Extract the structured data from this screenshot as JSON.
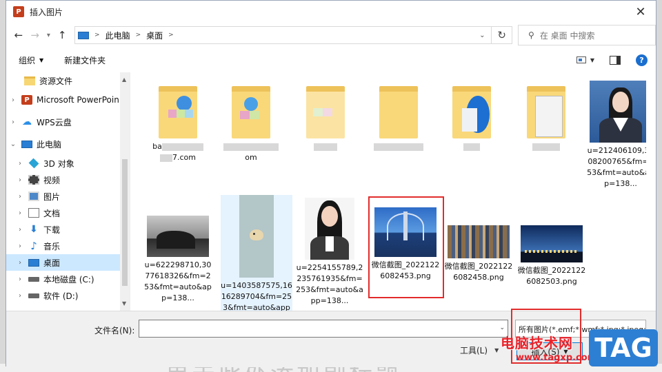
{
  "dialog": {
    "title": "插入图片"
  },
  "nav": {
    "path": [
      "此电脑",
      "桌面"
    ],
    "search_placeholder": "在 桌面 中搜索"
  },
  "toolbar": {
    "organize": "组织",
    "new_folder": "新建文件夹",
    "help": "?"
  },
  "sidebar": {
    "items": [
      {
        "label": "资源文件",
        "icon": "folder-icon"
      },
      {
        "label": "Microsoft PowerPoin",
        "icon": "powerpoint-icon"
      },
      {
        "label": "WPS云盘",
        "icon": "cloud-icon"
      },
      {
        "label": "此电脑",
        "icon": "computer-icon"
      },
      {
        "label": "3D 对象",
        "icon": "cube-icon"
      },
      {
        "label": "视频",
        "icon": "video-icon"
      },
      {
        "label": "图片",
        "icon": "picture-icon"
      },
      {
        "label": "文档",
        "icon": "document-icon"
      },
      {
        "label": "下载",
        "icon": "download-icon"
      },
      {
        "label": "音乐",
        "icon": "music-icon"
      },
      {
        "label": "桌面",
        "icon": "desktop-icon"
      },
      {
        "label": "本地磁盘 (C:)",
        "icon": "disk-icon"
      },
      {
        "label": "软件 (D:)",
        "icon": "disk-icon"
      }
    ]
  },
  "files": {
    "folder1_a": "ba",
    "folder1_b": "7.com",
    "folder2_b": "om",
    "img1": "u=212406109,3008200765&fm=253&fmt=auto&app=138...",
    "img2": "u=622298710,3077618326&fm=253&fmt=auto&app=138...",
    "img3": "u=1403587575,1616289704&fm=253&fmt=auto&app=120...",
    "img4": "u=2254155789,2235761935&fm=253&fmt=auto&app=138...",
    "img5": "微信截图_20221226082453.png",
    "img6": "微信截图_20221226082458.png",
    "img7": "微信截图_20221226082503.png"
  },
  "bottom": {
    "filename_label": "文件名(N):",
    "filename_value": "",
    "filetype": "所有图片(*.emf;*.wmf;*.jpg;*.jpeg;*.png)",
    "tools": "工具(L)",
    "insert": "插入(S)",
    "cancel": "取消"
  },
  "background": {
    "doc_text": "单击此处添加副标题"
  },
  "watermark": {
    "site_name": "电脑技术网",
    "url": "www.tagxp.com",
    "tag": "TAG"
  }
}
